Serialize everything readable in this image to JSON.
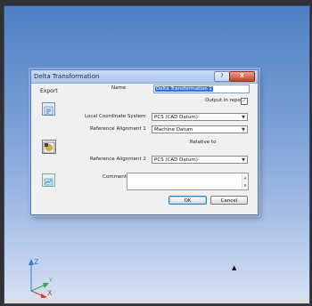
{
  "dialog": {
    "title": "Delta Transformation",
    "help_label": "?",
    "close_label": "X",
    "sidebar": {
      "export_label": "Export",
      "icons": [
        "export-icon",
        "transform-icon",
        "report-icon"
      ]
    },
    "name_label": "Name",
    "name_value": "Delta Transformation 1",
    "output_label": "Output in report",
    "output_checked": "✓",
    "lcs_label": "Local Coordinate System",
    "lcs_value": "PCS (CAD Datum)",
    "ref1_label": "Reference Alignment 1",
    "ref1_value": "Machine Datum",
    "relative_label": "Relative to",
    "ref2_label": "Reference Alignment 2",
    "ref2_value": "PCS (CAD Datum)",
    "comment_label": "Comment:",
    "ok_label": "OK",
    "cancel_label": "Cancel"
  },
  "viewport": {
    "axis_labels": {
      "z": "Z",
      "y": "Y",
      "x": "X"
    },
    "colors": {
      "z": "#2f7fd6",
      "y": "#2fa84a",
      "x": "#d23b3b"
    }
  }
}
